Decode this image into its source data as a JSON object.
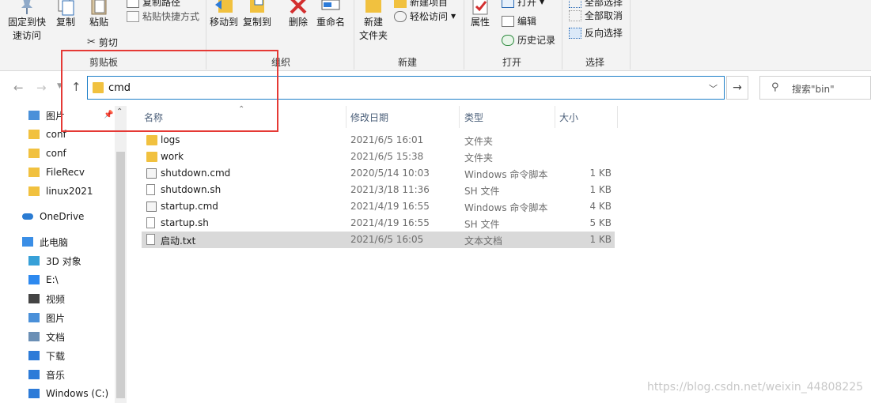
{
  "ribbon": {
    "clipboard": {
      "pin_quick_access": [
        "固定到快",
        "速访问"
      ],
      "copy": "复制",
      "paste": "粘贴",
      "copy_path": "复制路径",
      "paste_shortcut": "粘贴快捷方式",
      "cut": "剪切",
      "group_label": "剪贴板"
    },
    "organize": {
      "move_to": "移动到",
      "copy_to": "复制到",
      "delete": "删除",
      "rename": "重命名",
      "group_label": "组织"
    },
    "new": {
      "new_folder": [
        "新建",
        "文件夹"
      ],
      "new_item": "新建项目",
      "easy_access": "轻松访问",
      "group_label": "新建"
    },
    "open": {
      "properties": "属性",
      "open": "打开",
      "edit": "编辑",
      "history": "历史记录",
      "group_label": "打开"
    },
    "select": {
      "select_all": "全部选择",
      "select_none": "全部取消",
      "invert": "反向选择",
      "group_label": "选择"
    }
  },
  "address": {
    "path": "cmd",
    "search_placeholder": "搜索\"bin\""
  },
  "nav": {
    "items": [
      {
        "label": "图片",
        "icon": "pictures-icon",
        "color": "#4a90d9"
      },
      {
        "label": "conf",
        "icon": "folder-icon",
        "color": "#f1c13f"
      },
      {
        "label": "conf",
        "icon": "folder-icon",
        "color": "#f1c13f"
      },
      {
        "label": "FileRecv",
        "icon": "folder-icon",
        "color": "#f1c13f"
      },
      {
        "label": "linux2021",
        "icon": "folder-icon",
        "color": "#f1c13f"
      },
      {
        "label": "OneDrive",
        "icon": "onedrive-icon",
        "color": "#2b7cd3"
      },
      {
        "label": "此电脑",
        "icon": "pc-icon",
        "color": "#3a8ee6"
      },
      {
        "label": "3D 对象",
        "icon": "3d-objects-icon",
        "color": "#37a0d8"
      },
      {
        "label": "E:\\",
        "icon": "drive-icon",
        "color": "#2d89ef"
      },
      {
        "label": "视频",
        "icon": "videos-icon",
        "color": "#444444"
      },
      {
        "label": "图片",
        "icon": "pictures-icon",
        "color": "#4a90d9"
      },
      {
        "label": "文档",
        "icon": "documents-icon",
        "color": "#6b8fb5"
      },
      {
        "label": "下载",
        "icon": "downloads-icon",
        "color": "#2d7bd8"
      },
      {
        "label": "音乐",
        "icon": "music-icon",
        "color": "#2d7bd8"
      },
      {
        "label": "Windows (C:)",
        "icon": "windows-drive-icon",
        "color": "#2d7bd8"
      }
    ]
  },
  "list": {
    "columns": {
      "name": "名称",
      "date": "修改日期",
      "type": "类型",
      "size": "大小"
    },
    "rows": [
      {
        "name": "logs",
        "date": "2021/6/5 16:01",
        "type": "文件夹",
        "size": "",
        "icon": "folder"
      },
      {
        "name": "work",
        "date": "2021/6/5 15:38",
        "type": "文件夹",
        "size": "",
        "icon": "folder"
      },
      {
        "name": "shutdown.cmd",
        "date": "2020/5/14 10:03",
        "type": "Windows 命令脚本",
        "size": "1 KB",
        "icon": "cmd"
      },
      {
        "name": "shutdown.sh",
        "date": "2021/3/18 11:36",
        "type": "SH 文件",
        "size": "1 KB",
        "icon": "doc"
      },
      {
        "name": "startup.cmd",
        "date": "2021/4/19 16:55",
        "type": "Windows 命令脚本",
        "size": "4 KB",
        "icon": "cmd"
      },
      {
        "name": "startup.sh",
        "date": "2021/4/19 16:55",
        "type": "SH 文件",
        "size": "5 KB",
        "icon": "doc"
      },
      {
        "name": "启动.txt",
        "date": "2021/6/5 16:05",
        "type": "文本文档",
        "size": "1 KB",
        "icon": "doc",
        "selected": true
      }
    ]
  },
  "watermark": "https://blog.csdn.net/weixin_44808225"
}
